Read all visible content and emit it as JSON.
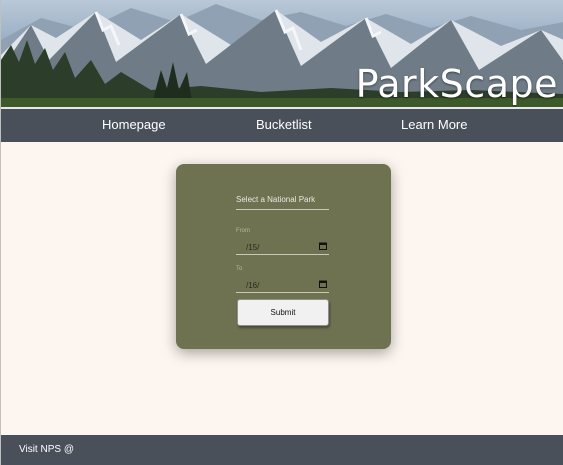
{
  "brand": {
    "title": "ParkScape"
  },
  "nav": {
    "items": [
      {
        "label": "Homepage"
      },
      {
        "label": "Bucketlist"
      },
      {
        "label": "Learn More"
      }
    ]
  },
  "form": {
    "park_select": {
      "placeholder": "Select a National Park"
    },
    "from": {
      "label": "From",
      "value": "/15/"
    },
    "to": {
      "label": "To",
      "value": "/16/"
    },
    "submit_label": "Submit"
  },
  "footer": {
    "text": "Visit NPS @"
  },
  "colors": {
    "nav_bg": "#4a505a",
    "page_bg": "#fdf6f0",
    "card_bg": "#6e7251"
  },
  "icons": {
    "date_picker": "calendar-icon"
  }
}
